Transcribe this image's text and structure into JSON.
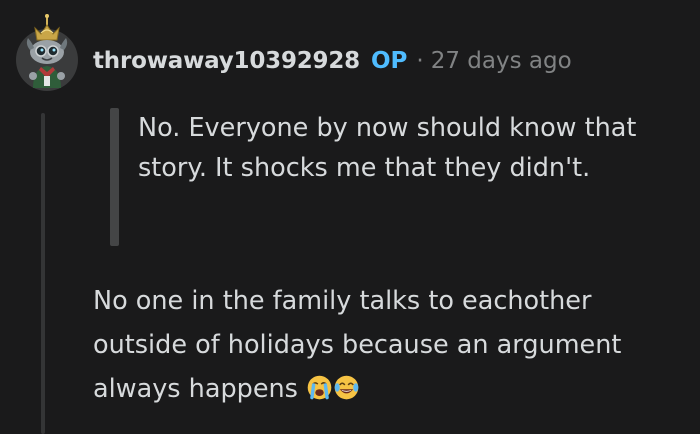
{
  "comment": {
    "author": "throwaway10392928",
    "op_badge": "OP",
    "separator": "·",
    "timestamp": "27 days ago",
    "quote": "No. Everyone by now should know that story. It shocks me that they didn't.",
    "body": "No one in the family talks to eachother outside of holidays because an argument always happens",
    "emojis": [
      "loudly-crying-face-icon",
      "face-with-tears-of-joy-icon"
    ]
  },
  "colors": {
    "background": "#1a1a1b",
    "text": "#d7dadc",
    "muted": "#818384",
    "op_accent": "#4fbcff",
    "thread_line": "#343536",
    "quote_bar": "#444546"
  }
}
